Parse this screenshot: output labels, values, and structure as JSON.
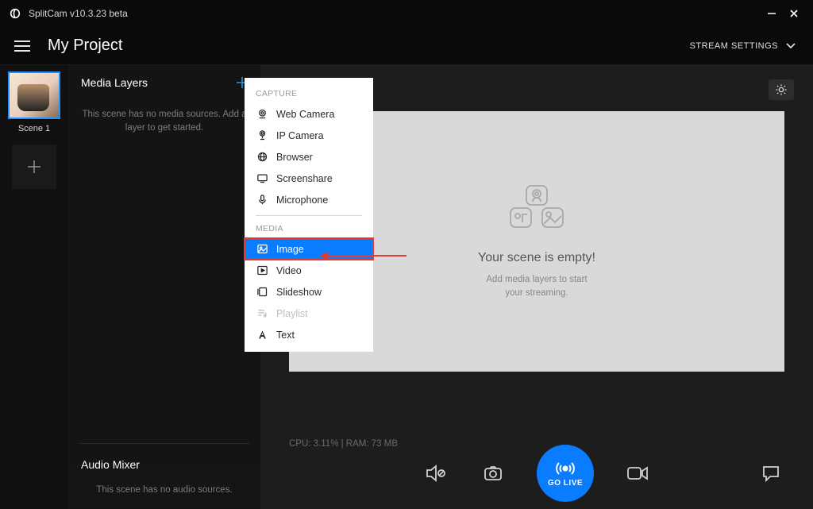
{
  "window": {
    "title": "SplitCam v10.3.23 beta"
  },
  "header": {
    "project_title": "My Project",
    "stream_settings": "STREAM SETTINGS"
  },
  "sidebar": {
    "scene_label": "Scene 1"
  },
  "panel": {
    "media_layers_title": "Media Layers",
    "media_hint": "This scene has no media sources. Add a layer to get started.",
    "audio_title": "Audio Mixer",
    "audio_hint": "This scene has no audio sources."
  },
  "popup": {
    "capture_label": "CAPTURE",
    "media_label": "MEDIA",
    "items_capture": [
      {
        "label": "Web Camera",
        "icon": "camera-icon"
      },
      {
        "label": "IP Camera",
        "icon": "ipcam-icon"
      },
      {
        "label": "Browser",
        "icon": "globe-icon"
      },
      {
        "label": "Screenshare",
        "icon": "screenshare-icon"
      },
      {
        "label": "Microphone",
        "icon": "mic-icon"
      }
    ],
    "items_media": [
      {
        "label": "Image",
        "icon": "image-icon",
        "selected": true
      },
      {
        "label": "Video",
        "icon": "video-icon"
      },
      {
        "label": "Slideshow",
        "icon": "slideshow-icon"
      },
      {
        "label": "Playlist",
        "icon": "playlist-icon",
        "disabled": true
      },
      {
        "label": "Text",
        "icon": "text-icon"
      }
    ]
  },
  "preview": {
    "empty_title": "Your scene is empty!",
    "empty_sub_line1": "Add media layers to start",
    "empty_sub_line2": "your streaming.",
    "sysinfo": "CPU: 3.11% | RAM: 73 MB",
    "golive_label": "GO LIVE"
  }
}
